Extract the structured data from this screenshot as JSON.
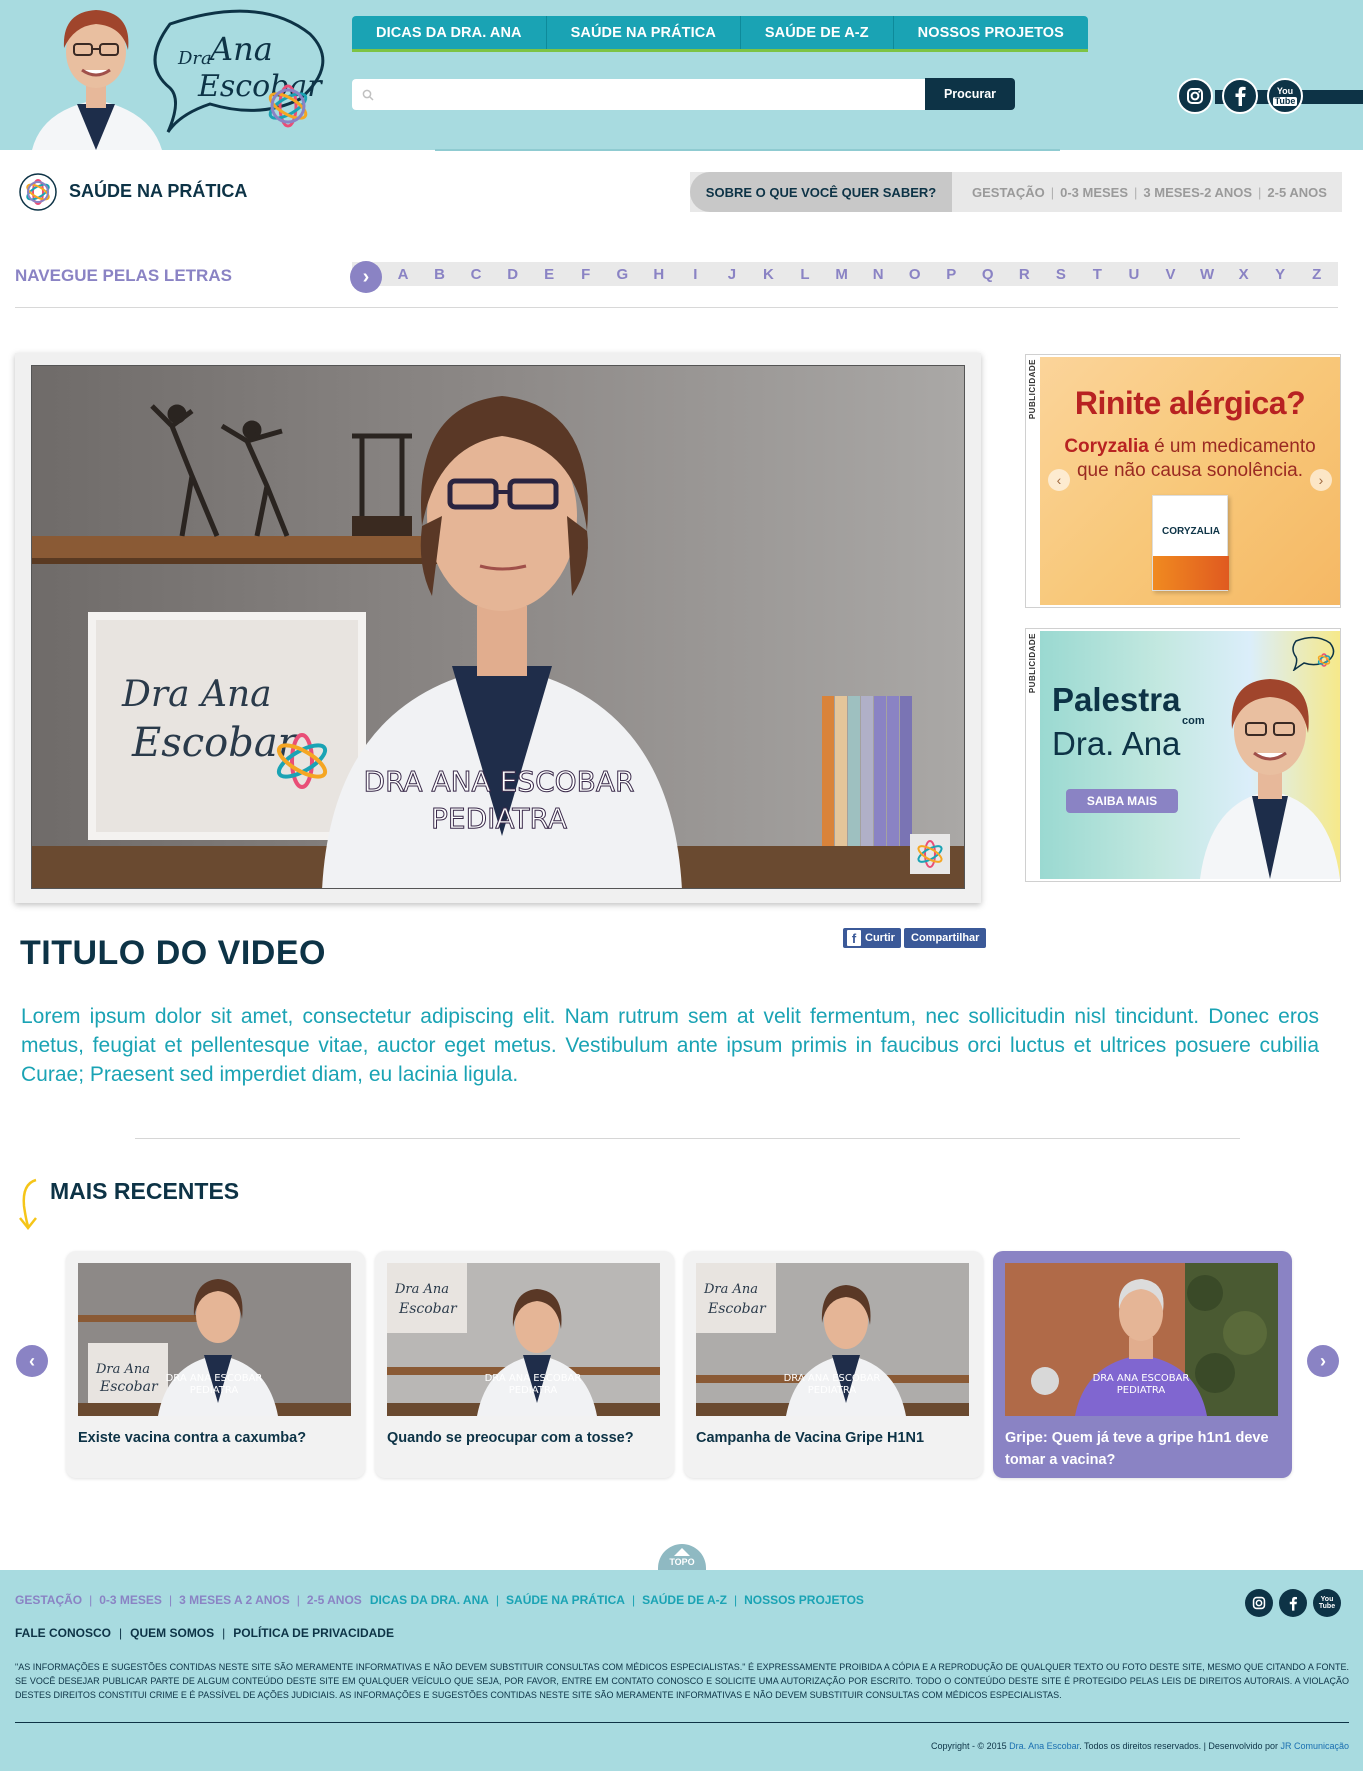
{
  "header": {
    "nav": [
      "DICAS DA DRA. ANA",
      "SAÚDE NA PRÁTICA",
      "SAÚDE DE A-Z",
      "NOSSOS PROJETOS"
    ],
    "search_placeholder": "",
    "search_button": "Procurar",
    "logo_line1": "Dra",
    "logo_line2": "Ana",
    "logo_line3": "Escobar",
    "social": [
      "instagram-icon",
      "facebook-icon",
      "youtube-icon"
    ],
    "youtube_label_1": "You",
    "youtube_label_2": "Tube"
  },
  "section": {
    "title": "SAÚDE NA PRÁTICA",
    "question": "SOBRE O QUE VOCÊ QUER SABER?",
    "topics": [
      "GESTAÇÃO",
      "0-3 MESES",
      "3 MESES-2 ANOS",
      "2-5 ANOS"
    ]
  },
  "alphabet": {
    "label": "NAVEGUE PELAS LETRAS",
    "letters": [
      "A",
      "B",
      "C",
      "D",
      "E",
      "F",
      "G",
      "H",
      "I",
      "J",
      "K",
      "L",
      "M",
      "N",
      "O",
      "P",
      "Q",
      "R",
      "S",
      "T",
      "U",
      "V",
      "W",
      "X",
      "Y",
      "Z"
    ]
  },
  "video": {
    "caption_line1": "DRA ANA ESCOBAR",
    "caption_line2": "PEDIATRA",
    "title": "TITULO DO VIDEO",
    "like": "Curtir",
    "share": "Compartilhar",
    "description": "Lorem ipsum dolor sit amet, consectetur adipiscing elit. Nam rutrum sem at velit fermentum, nec sollicitudin nisl tincidunt. Donec eros metus, feugiat et pellentesque vitae, auctor eget metus. Vestibulum ante ipsum primis in faucibus orci luctus et ultrices posuere cubilia Curae; Praesent sed imperdiet diam, eu lacinia ligula."
  },
  "ads": {
    "label": "PUBLICIDADE",
    "ad1": {
      "headline": "Rinite alérgica?",
      "brand": "Coryzalia",
      "line1_rest": " é um medicamento",
      "line2": "que não causa sonolência.",
      "box_brand": "CORYZALIA"
    },
    "ad2": {
      "title": "Palestra",
      "com": "com",
      "name": "Dra. Ana",
      "button": "SAIBA MAIS"
    }
  },
  "recent": {
    "title": "MAIS RECENTES",
    "thumb_caption_1": "DRA ANA ESCOBAR",
    "thumb_caption_2": "PEDIATRA",
    "items": [
      {
        "title": "Existe vacina contra a caxumba?"
      },
      {
        "title": "Quando se preocupar com a tosse?"
      },
      {
        "title": "Campanha de Vacina Gripe H1N1"
      },
      {
        "title": "Gripe: Quem já teve a gripe h1n1 deve tomar a vacina?"
      }
    ],
    "active_index": 3
  },
  "footer": {
    "topo": "TOPO",
    "topics": [
      "GESTAÇÃO",
      "0-3 MESES",
      "3 MESES A 2 ANOS",
      "2-5 ANOS"
    ],
    "nav": [
      "DICAS DA DRA. ANA",
      "SAÚDE NA PRÁTICA",
      "SAÚDE DE A-Z",
      "NOSSOS PROJETOS"
    ],
    "institutional": [
      "FALE CONOSCO",
      "QUEM SOMOS",
      "POLÍTICA DE PRIVACIDADE"
    ],
    "disclaimer": "\"AS INFORMAÇÕES E SUGESTÕES CONTIDAS NESTE SITE SÃO MERAMENTE INFORMATIVAS E NÃO DEVEM SUBSTITUIR CONSULTAS COM MÉDICOS ESPECIALISTAS.\" É EXPRESSAMENTE PROIBIDA A CÓPIA E A REPRODUÇÃO DE QUALQUER TEXTO OU FOTO DESTE SITE, MESMO QUE CITANDO A FONTE. SE VOCÊ DESEJAR PUBLICAR PARTE DE ALGUM CONTEÚDO DESTE SITE EM QUALQUER VEÍCULO QUE SEJA, POR FAVOR, ENTRE EM CONTATO CONOSCO E SOLICITE UMA AUTORIZAÇÃO POR ESCRITO. TODO O CONTEÚDO DESTE SITE É PROTEGIDO PELAS LEIS DE DIREITOS AUTORAIS. A VIOLAÇÃO DESTES DIREITOS CONSTITUI CRIME E É PASSÍVEL DE AÇÕES JUDICIAIS. AS INFORMAÇÕES E SUGESTÕES CONTIDAS NESTE SITE SÃO MERAMENTE INFORMATIVAS E NÃO DEVEM SUBSTITUIR CONSULTAS COM MÉDICOS ESPECIALISTAS.",
    "copyright_prefix": "Copyright - © 2015 ",
    "copyright_name": "Dra. Ana Escobar",
    "copyright_mid": ". Todos os direitos reservados. | Desenvolvido por ",
    "copyright_dev": "JR Comunicação"
  },
  "colors": {
    "teal_bg": "#a8dbe0",
    "teal_accent": "#1aa3b4",
    "navy": "#0d3346",
    "purple": "#8a83c4",
    "green": "#7dc344"
  }
}
